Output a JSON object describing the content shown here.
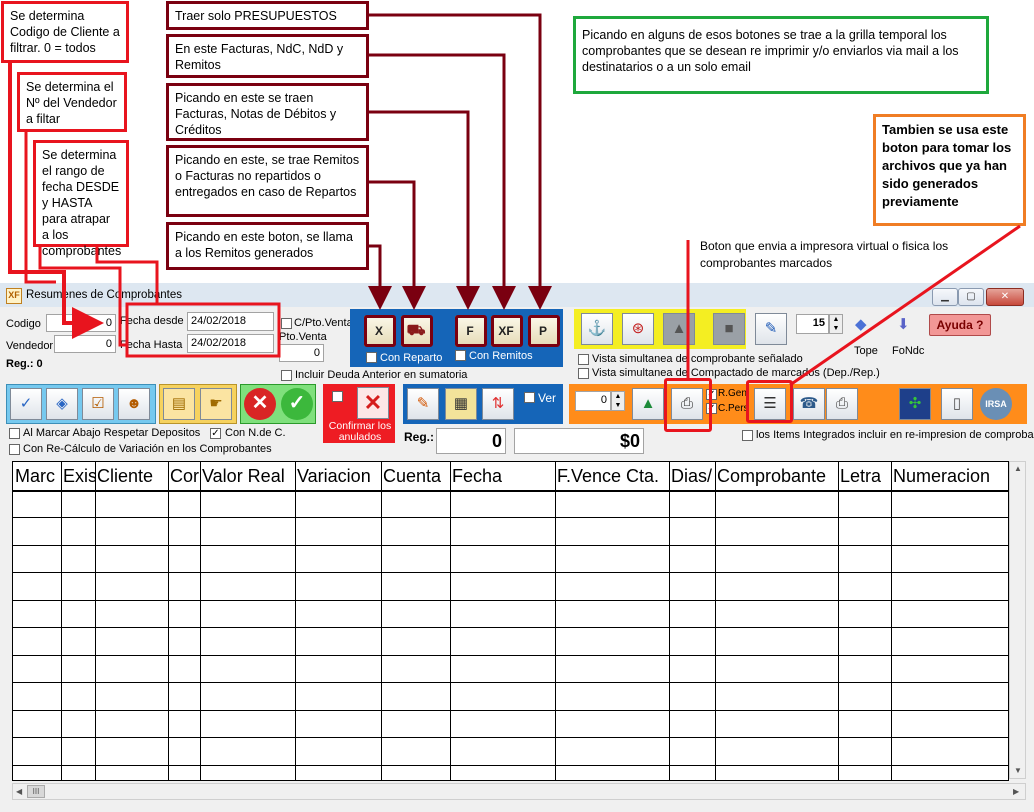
{
  "notes": {
    "cliente": "Se determina Codigo de Cliente a filtrar. 0 = todos",
    "vendedor": "Se determina el Nº del Vendedor a filtar",
    "fecha": "Se determina el rango de fecha DESDE y HASTA para atrapar a los comprobantes",
    "presupuestos": "Traer solo PRESUPUESTOS",
    "facturas": "En este Facturas, NdC, NdD y Remitos",
    "notas": "Picando en este se traen Facturas, Notas de Débitos y Créditos",
    "remitos": "Picando en este, se trae Remitos o Facturas no repartidos o entregados en caso de Repartos",
    "generados": "Picando en este boton, se llama a los Remitos generados",
    "grilla": "Picando en alguns de esos botones se trae a la grilla temporal los comprobantes que se desean re imprimir y/o enviarlos via mail a los destinatarios o a un solo email",
    "archivos": "Tambien se usa este boton para tomar los archivos que ya han sido generados previamente",
    "impresora": "Boton que envia a impresora virtual o fisica los comprobantes marcados"
  },
  "window": {
    "title": "Resumenes de Comprobantes",
    "icon_text": "XF"
  },
  "filters": {
    "codigo_label": "Codigo",
    "codigo_value": "0",
    "vendedor_label": "Vendedor",
    "vendedor_value": "0",
    "reg_label": "Reg.: 0",
    "fecha_desde_label": "Fecha desde",
    "fecha_desde_value": "24/02/2018",
    "fecha_hasta_label": "Fecha Hasta",
    "fecha_hasta_value": "24/02/2018",
    "cpto_label": "C/Pto.Venta",
    "pto_label": "Pto.Venta",
    "pto_value": "0",
    "deuda_label": "Incluir Deuda Anterior en sumatoria"
  },
  "blue_panel": {
    "buttons": [
      "X",
      "F",
      "XF",
      "P"
    ],
    "con_reparto": "Con Reparto",
    "con_remitos": "Con Remitos"
  },
  "right_panel": {
    "spinner_value": "15",
    "tope": "Tope",
    "fondc": "FoNdc",
    "ayuda": "Ayuda ?",
    "vista1": "Vista simultanea de comprobante señalado",
    "vista2": "Vista simultanea de Compactado de marcados (Dep./Rep.)"
  },
  "row2": {
    "confirmar": "Confirmar los anulados",
    "ver": "Ver",
    "reg_label": "Reg.:",
    "reg_value": "0",
    "total_value": "$0",
    "spin2": "0",
    "rgen": "R.Gen",
    "cpers": "C.Pers",
    "irsa": "IRSA",
    "items_label": "los Items Integrados incluir en re-impresion de comproba",
    "al_marcar": "Al Marcar Abajo Respetar Depositos",
    "con_ndec": "Con N.de C.",
    "recalculo": "Con Re-Cálculo de Variación en los Comprobantes"
  },
  "grid": {
    "columns": [
      "Marc",
      "Exis",
      "Cliente",
      "Cor",
      "Valor Real",
      "Variacion",
      "Cuenta",
      "Fecha",
      "F.Vence Cta.",
      "Dias/",
      "Comprobante",
      "Letra",
      "Numeracion"
    ],
    "hscroll_thumb": "III"
  }
}
